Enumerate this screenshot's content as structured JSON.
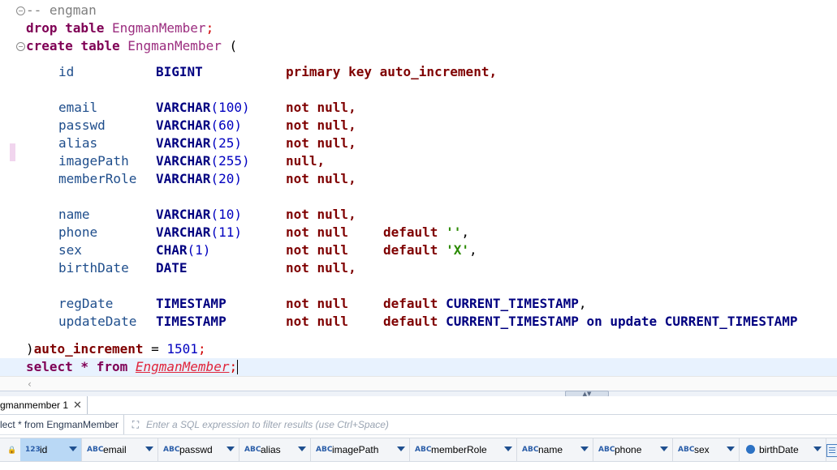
{
  "editor": {
    "comment": "-- engman",
    "drop": {
      "kw": "drop table",
      "table": "EngmanMember",
      "semi": ";"
    },
    "create": {
      "kw": "create table",
      "table": "EngmanMember",
      "paren": " ("
    },
    "columns": [
      {
        "name": "id",
        "type": "BIGINT",
        "args": "",
        "constraint": "primary key auto_increment,",
        "def_kw": "",
        "def_val": "",
        "def_rest": ""
      },
      {
        "name": "email",
        "type": "VARCHAR",
        "args": "(100)",
        "constraint": "not null,",
        "def_kw": "",
        "def_val": "",
        "def_rest": ""
      },
      {
        "name": "passwd",
        "type": "VARCHAR",
        "args": "(60)",
        "constraint": "not null,",
        "def_kw": "",
        "def_val": "",
        "def_rest": ""
      },
      {
        "name": "alias",
        "type": "VARCHAR",
        "args": "(25)",
        "constraint": "not null,",
        "def_kw": "",
        "def_val": "",
        "def_rest": ""
      },
      {
        "name": "imagePath",
        "type": "VARCHAR",
        "args": "(255)",
        "constraint": "null,",
        "def_kw": "",
        "def_val": "",
        "def_rest": ""
      },
      {
        "name": "memberRole",
        "type": "VARCHAR",
        "args": "(20)",
        "constraint": "not null,",
        "def_kw": "",
        "def_val": "",
        "def_rest": ""
      },
      {
        "name": "name",
        "type": "VARCHAR",
        "args": "(10)",
        "constraint": "not null,",
        "def_kw": "",
        "def_val": "",
        "def_rest": ""
      },
      {
        "name": "phone",
        "type": "VARCHAR",
        "args": "(11)",
        "constraint": "not null",
        "def_kw": "default",
        "def_val": "''",
        "def_rest": ","
      },
      {
        "name": "sex",
        "type": "CHAR",
        "args": "(1)",
        "constraint": "not null",
        "def_kw": "default",
        "def_val": "'X'",
        "def_rest": ","
      },
      {
        "name": "birthDate",
        "type": "DATE",
        "args": "",
        "constraint": "not null,",
        "def_kw": "",
        "def_val": "",
        "def_rest": ""
      },
      {
        "name": "regDate",
        "type": "TIMESTAMP",
        "args": "",
        "constraint": "not null",
        "def_kw": "default",
        "def_val": "CURRENT_TIMESTAMP",
        "def_rest": ","
      },
      {
        "name": "updateDate",
        "type": "TIMESTAMP",
        "args": "",
        "constraint": "not null",
        "def_kw": "default",
        "def_val": "CURRENT_TIMESTAMP on update CURRENT_TIMESTAMP",
        "def_rest": ""
      }
    ],
    "closing": {
      "paren": ")",
      "kw": "auto_increment",
      "eq": " = ",
      "num": "1501",
      "semi": ";"
    },
    "select": {
      "kw": "select * from ",
      "table": "EngmanMember",
      "semi": ";"
    }
  },
  "results": {
    "tab_label": "gmanmember 1",
    "query_label": "lect * from EngmanMember",
    "filter_placeholder": "Enter a SQL expression to filter results (use Ctrl+Space)",
    "columns": [
      {
        "tag": "123",
        "name": "id"
      },
      {
        "tag": "ABC",
        "name": "email"
      },
      {
        "tag": "ABC",
        "name": "passwd"
      },
      {
        "tag": "ABC",
        "name": "alias"
      },
      {
        "tag": "ABC",
        "name": "imagePath"
      },
      {
        "tag": "ABC",
        "name": "memberRole"
      },
      {
        "tag": "ABC",
        "name": "name"
      },
      {
        "tag": "ABC",
        "name": "phone"
      },
      {
        "tag": "ABC",
        "name": "sex"
      },
      {
        "tag": "",
        "name": "birthDate"
      }
    ]
  }
}
